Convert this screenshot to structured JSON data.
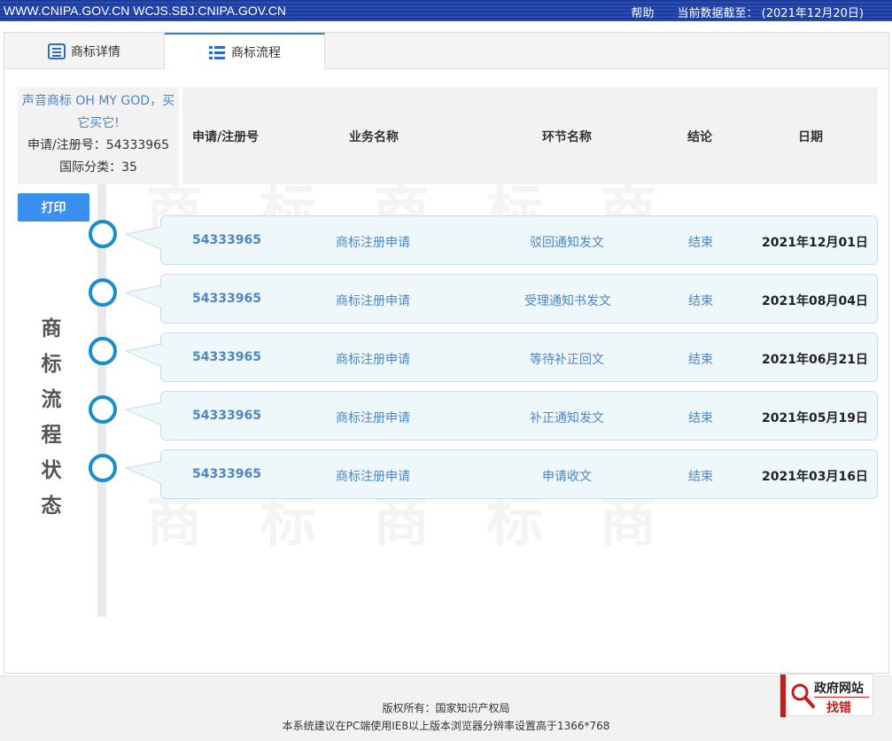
{
  "topbar": {
    "sites": "WWW.CNIPA.GOV.CN WCJS.SBJ.CNIPA.GOV.CN",
    "help": "帮助",
    "data_as_of": "当前数据截至：  (2021年12月20日)"
  },
  "tabs": [
    {
      "label": "商标详情",
      "icon": "document-list-icon",
      "active": false
    },
    {
      "label": "商标流程",
      "icon": "list-icon",
      "active": true
    }
  ],
  "trademark": {
    "name": "声音商标 OH MY GOD，买它买它!",
    "reg_no_line": "申请/注册号：54333965",
    "class_line": "国际分类：35"
  },
  "table_headers": {
    "app_no": "申请/注册号",
    "business": "业务名称",
    "stage": "环节名称",
    "result": "结论",
    "date": "日期"
  },
  "print_label": "打印",
  "side_title": [
    "商",
    "标",
    "流",
    "程",
    "状",
    "态"
  ],
  "records": [
    {
      "app_no": "54333965",
      "business": "商标注册申请",
      "stage": "驳回通知发文",
      "result": "结束",
      "date": "2021年12月01日"
    },
    {
      "app_no": "54333965",
      "business": "商标注册申请",
      "stage": "受理通知书发文",
      "result": "结束",
      "date": "2021年08月04日"
    },
    {
      "app_no": "54333965",
      "business": "商标注册申请",
      "stage": "等待补正回文",
      "result": "结束",
      "date": "2021年06月21日"
    },
    {
      "app_no": "54333965",
      "business": "商标注册申请",
      "stage": "补正通知发文",
      "result": "结束",
      "date": "2021年05月19日"
    },
    {
      "app_no": "54333965",
      "business": "商标注册申请",
      "stage": "申请收文",
      "result": "结束",
      "date": "2021年03月16日"
    }
  ],
  "footer": {
    "copyright": "版权所有：国家知识产权局",
    "recommendation": "本系统建议在PC端使用IE8以上版本浏览器分辨率设置高于1366*768"
  },
  "badge": {
    "line1": "政府网站",
    "line2": "找错",
    "icon": "magnifier-icon",
    "accent": "#c91a1a"
  },
  "colors": {
    "link": "#4f86c6",
    "accent_blue": "#3b8ff0",
    "timeline": "#1a8ec9",
    "topbar": "#1d3c9a"
  }
}
